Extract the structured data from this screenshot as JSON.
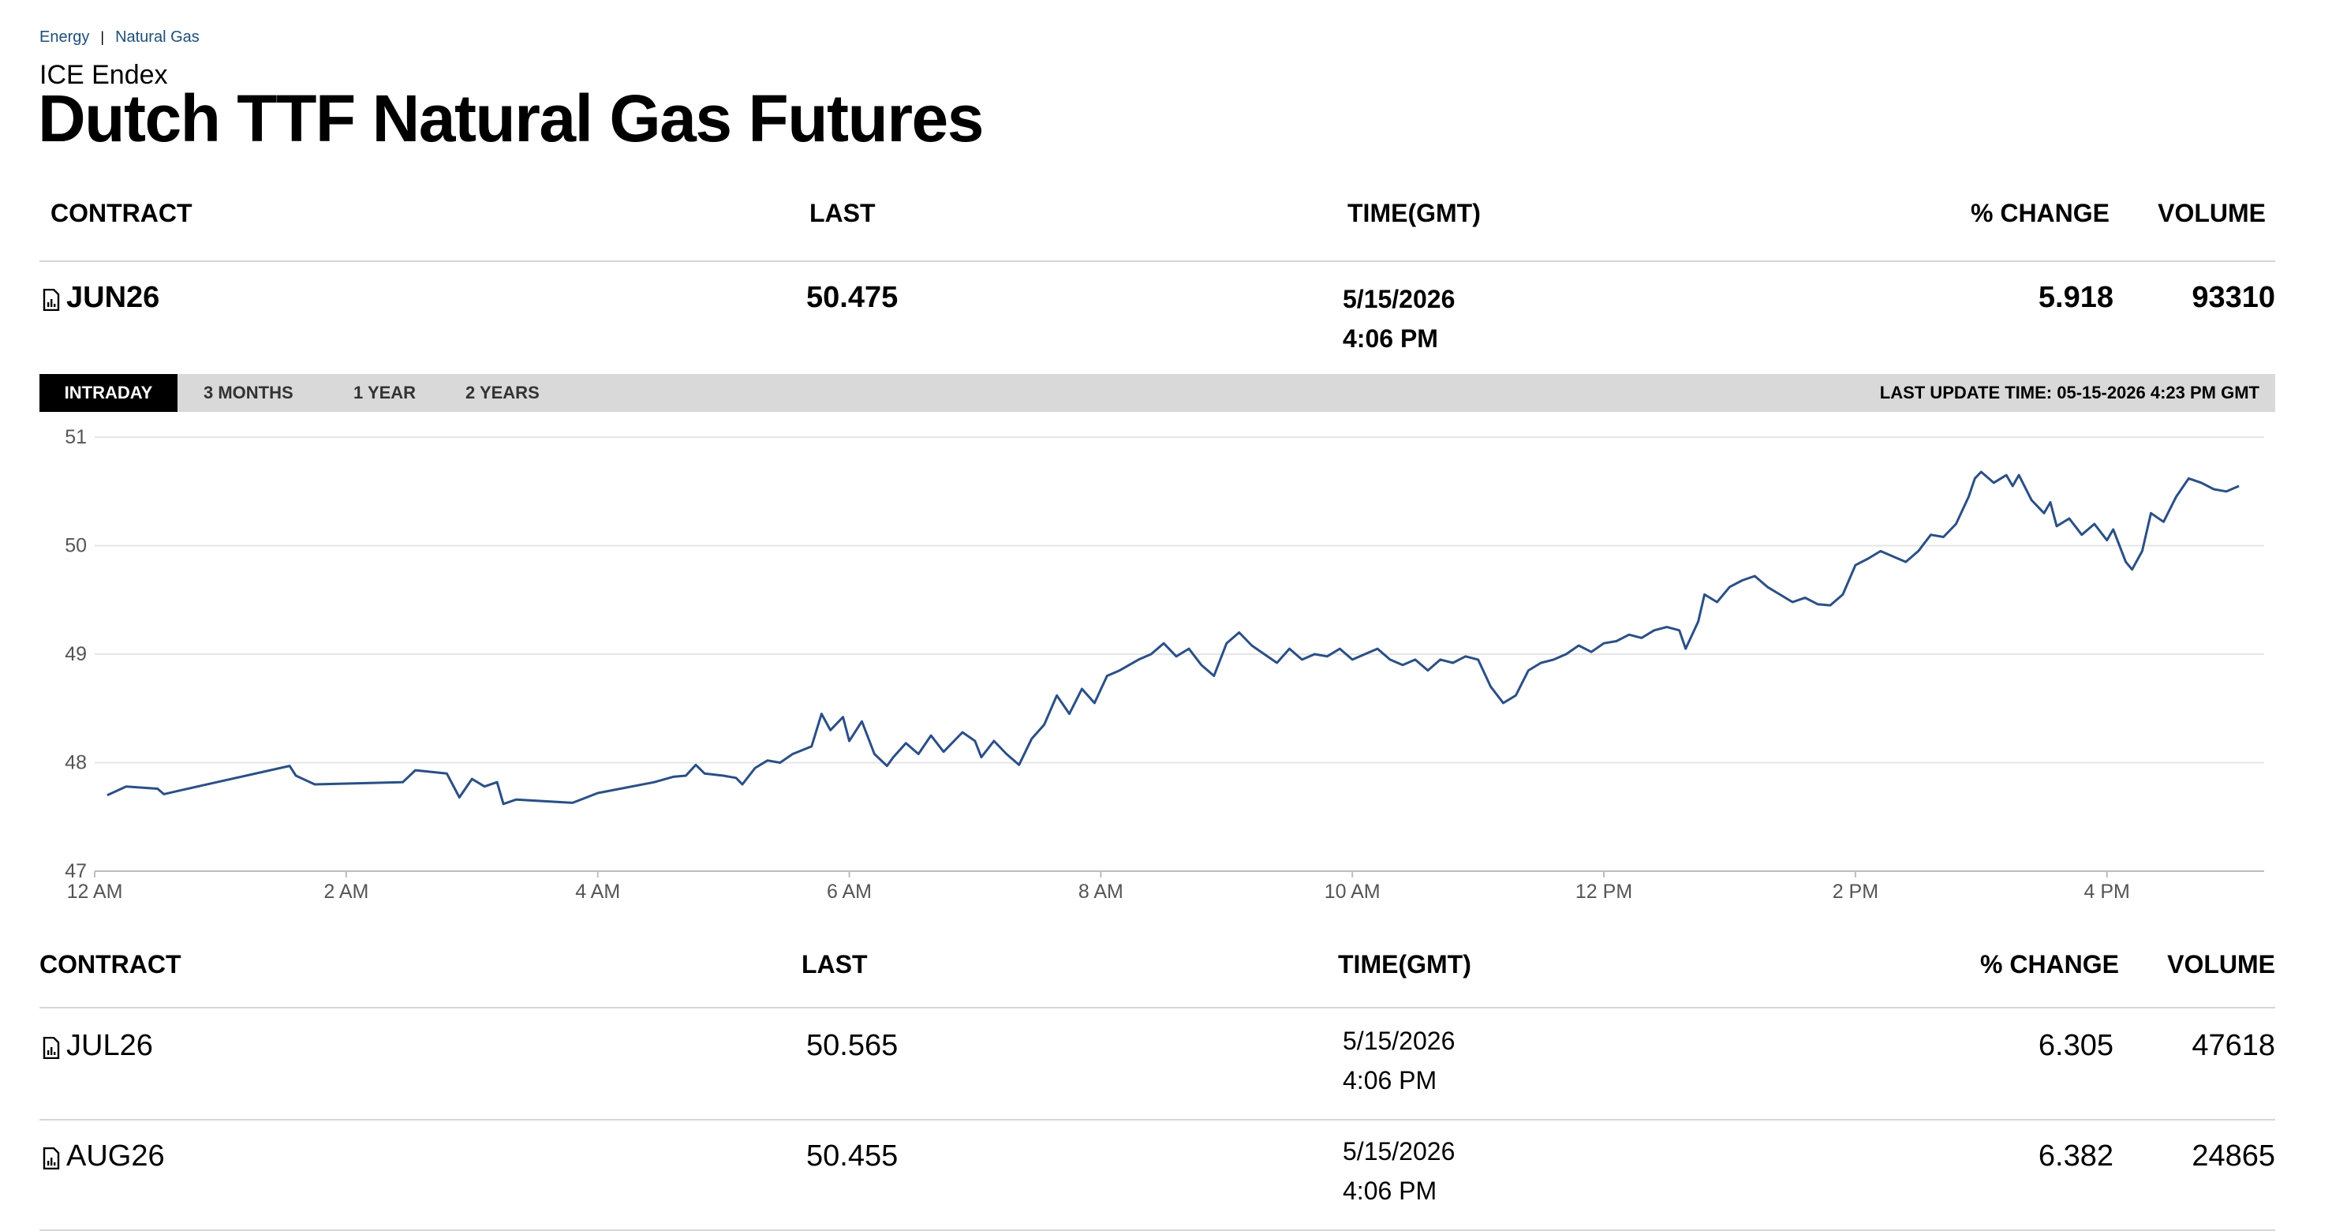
{
  "breadcrumb": {
    "items": [
      "Energy",
      "Natural Gas"
    ],
    "separator": "|"
  },
  "exchange": "ICE Endex",
  "title": "Dutch TTF Natural Gas Futures",
  "columns": {
    "contract": "CONTRACT",
    "last": "LAST",
    "time": "TIME(GMT)",
    "change": "% CHANGE",
    "volume": "VOLUME"
  },
  "front": {
    "contract": "JUN26",
    "last": "50.475",
    "date": "5/15/2026",
    "time": "4:06 PM",
    "change": "5.918",
    "volume": "93310"
  },
  "tabs": [
    "INTRADAY",
    "3 MONTHS",
    "1 YEAR",
    "2 YEARS"
  ],
  "active_tab": "INTRADAY",
  "last_update": "LAST UPDATE TIME: 05-15-2026 4:23 PM GMT",
  "other_contracts": [
    {
      "contract": "JUL26",
      "last": "50.565",
      "date": "5/15/2026",
      "time": "4:06 PM",
      "change": "6.305",
      "volume": "47618"
    },
    {
      "contract": "AUG26",
      "last": "50.455",
      "date": "5/15/2026",
      "time": "4:06 PM",
      "change": "6.382",
      "volume": "24865"
    }
  ],
  "colors": {
    "line": "#2b4f86",
    "tab_active_bg": "#000000",
    "tabbar_bg": "#d9d9d9",
    "grid": "#e6e6e6"
  },
  "chart_data": {
    "type": "line",
    "xlabel": "",
    "ylabel": "",
    "ylim": [
      47,
      51
    ],
    "yticks": [
      "47",
      "48",
      "49",
      "50",
      "51"
    ],
    "xticks": [
      "12 AM",
      "2 AM",
      "4 AM",
      "6 AM",
      "8 AM",
      "10 AM",
      "12 PM",
      "2 PM",
      "4 PM"
    ],
    "x_unit": "hours since 12 AM",
    "grid": true,
    "series": [
      {
        "values": [
          [
            0.1,
            47.7
          ],
          [
            0.25,
            47.78
          ],
          [
            0.5,
            47.76
          ],
          [
            0.55,
            47.71
          ],
          [
            0.7,
            47.75
          ],
          [
            1.55,
            47.97
          ],
          [
            1.6,
            47.88
          ],
          [
            1.75,
            47.8
          ],
          [
            2.45,
            47.82
          ],
          [
            2.55,
            47.93
          ],
          [
            2.8,
            47.9
          ],
          [
            2.9,
            47.68
          ],
          [
            3.0,
            47.85
          ],
          [
            3.1,
            47.78
          ],
          [
            3.2,
            47.82
          ],
          [
            3.25,
            47.62
          ],
          [
            3.35,
            47.66
          ],
          [
            3.8,
            47.63
          ],
          [
            4.0,
            47.72
          ],
          [
            4.45,
            47.82
          ],
          [
            4.6,
            47.87
          ],
          [
            4.7,
            47.88
          ],
          [
            4.78,
            47.98
          ],
          [
            4.85,
            47.9
          ],
          [
            5.0,
            47.88
          ],
          [
            5.1,
            47.86
          ],
          [
            5.15,
            47.8
          ],
          [
            5.25,
            47.95
          ],
          [
            5.35,
            48.02
          ],
          [
            5.45,
            48.0
          ],
          [
            5.55,
            48.08
          ],
          [
            5.7,
            48.15
          ],
          [
            5.78,
            48.45
          ],
          [
            5.85,
            48.3
          ],
          [
            5.95,
            48.42
          ],
          [
            6.0,
            48.2
          ],
          [
            6.1,
            48.38
          ],
          [
            6.2,
            48.08
          ],
          [
            6.3,
            47.97
          ],
          [
            6.35,
            48.05
          ],
          [
            6.45,
            48.18
          ],
          [
            6.55,
            48.08
          ],
          [
            6.65,
            48.25
          ],
          [
            6.75,
            48.1
          ],
          [
            6.9,
            48.28
          ],
          [
            7.0,
            48.2
          ],
          [
            7.05,
            48.05
          ],
          [
            7.15,
            48.2
          ],
          [
            7.25,
            48.08
          ],
          [
            7.35,
            47.98
          ],
          [
            7.45,
            48.22
          ],
          [
            7.55,
            48.35
          ],
          [
            7.65,
            48.62
          ],
          [
            7.75,
            48.45
          ],
          [
            7.85,
            48.68
          ],
          [
            7.95,
            48.55
          ],
          [
            8.05,
            48.8
          ],
          [
            8.15,
            48.85
          ],
          [
            8.3,
            48.95
          ],
          [
            8.4,
            49.0
          ],
          [
            8.5,
            49.1
          ],
          [
            8.6,
            48.98
          ],
          [
            8.7,
            49.05
          ],
          [
            8.8,
            48.9
          ],
          [
            8.9,
            48.8
          ],
          [
            9.0,
            49.1
          ],
          [
            9.1,
            49.2
          ],
          [
            9.2,
            49.08
          ],
          [
            9.3,
            49.0
          ],
          [
            9.4,
            48.92
          ],
          [
            9.5,
            49.05
          ],
          [
            9.6,
            48.95
          ],
          [
            9.7,
            49.0
          ],
          [
            9.8,
            48.98
          ],
          [
            9.9,
            49.05
          ],
          [
            10.0,
            48.95
          ],
          [
            10.1,
            49.0
          ],
          [
            10.2,
            49.05
          ],
          [
            10.3,
            48.95
          ],
          [
            10.4,
            48.9
          ],
          [
            10.5,
            48.95
          ],
          [
            10.6,
            48.85
          ],
          [
            10.7,
            48.95
          ],
          [
            10.8,
            48.92
          ],
          [
            10.9,
            48.98
          ],
          [
            11.0,
            48.95
          ],
          [
            11.1,
            48.7
          ],
          [
            11.2,
            48.55
          ],
          [
            11.3,
            48.62
          ],
          [
            11.4,
            48.85
          ],
          [
            11.5,
            48.92
          ],
          [
            11.6,
            48.95
          ],
          [
            11.7,
            49.0
          ],
          [
            11.8,
            49.08
          ],
          [
            11.9,
            49.02
          ],
          [
            12.0,
            49.1
          ],
          [
            12.1,
            49.12
          ],
          [
            12.2,
            49.18
          ],
          [
            12.3,
            49.15
          ],
          [
            12.4,
            49.22
          ],
          [
            12.5,
            49.25
          ],
          [
            12.6,
            49.22
          ],
          [
            12.65,
            49.05
          ],
          [
            12.75,
            49.3
          ],
          [
            12.8,
            49.55
          ],
          [
            12.9,
            49.48
          ],
          [
            13.0,
            49.62
          ],
          [
            13.1,
            49.68
          ],
          [
            13.2,
            49.72
          ],
          [
            13.3,
            49.62
          ],
          [
            13.4,
            49.55
          ],
          [
            13.5,
            49.48
          ],
          [
            13.6,
            49.52
          ],
          [
            13.7,
            49.46
          ],
          [
            13.8,
            49.45
          ],
          [
            13.9,
            49.55
          ],
          [
            14.0,
            49.82
          ],
          [
            14.1,
            49.88
          ],
          [
            14.2,
            49.95
          ],
          [
            14.3,
            49.9
          ],
          [
            14.4,
            49.85
          ],
          [
            14.5,
            49.95
          ],
          [
            14.6,
            50.1
          ],
          [
            14.7,
            50.08
          ],
          [
            14.8,
            50.2
          ],
          [
            14.9,
            50.45
          ],
          [
            14.95,
            50.62
          ],
          [
            15.0,
            50.68
          ],
          [
            15.1,
            50.58
          ],
          [
            15.2,
            50.65
          ],
          [
            15.25,
            50.55
          ],
          [
            15.3,
            50.65
          ],
          [
            15.4,
            50.42
          ],
          [
            15.5,
            50.3
          ],
          [
            15.55,
            50.4
          ],
          [
            15.6,
            50.18
          ],
          [
            15.7,
            50.25
          ],
          [
            15.8,
            50.1
          ],
          [
            15.9,
            50.2
          ],
          [
            16.0,
            50.05
          ],
          [
            16.05,
            50.15
          ],
          [
            16.15,
            49.85
          ],
          [
            16.2,
            49.78
          ],
          [
            16.28,
            49.95
          ],
          [
            16.35,
            50.3
          ],
          [
            16.45,
            50.22
          ],
          [
            16.55,
            50.45
          ],
          [
            16.65,
            50.62
          ],
          [
            16.75,
            50.58
          ],
          [
            16.85,
            50.52
          ],
          [
            16.95,
            50.5
          ],
          [
            17.05,
            50.55
          ]
        ]
      }
    ]
  }
}
